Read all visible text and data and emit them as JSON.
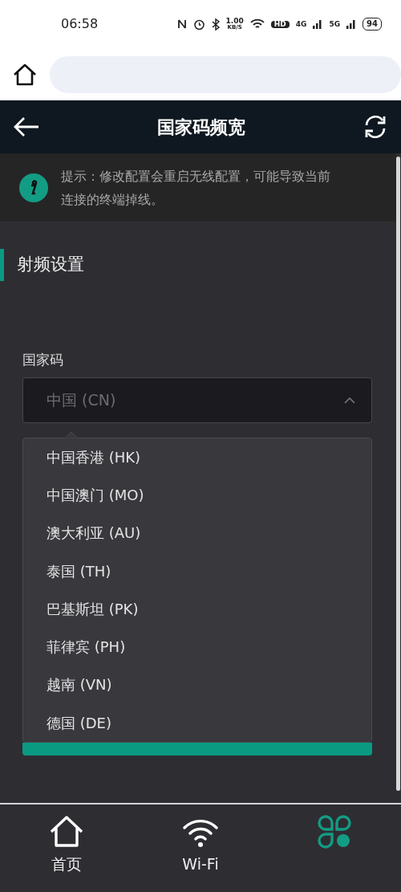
{
  "status_bar": {
    "time": "06:58",
    "net_speed": "1.00",
    "net_unit": "KB/S",
    "hd": "HD",
    "signal_1": "4G",
    "signal_2": "5G",
    "battery": "94"
  },
  "header": {
    "title": "国家码频宽"
  },
  "notice": {
    "text": "提示：修改配置会重启无线配置，可能导致当前连接的终端掉线。"
  },
  "section": {
    "title": "射频设置"
  },
  "country_field": {
    "label": "国家码",
    "value": "中国 (CN)",
    "expanded": true,
    "options": [
      {
        "label": "中国香港 (HK)"
      },
      {
        "label": "中国澳门 (MO)"
      },
      {
        "label": "澳大利亚 (AU)"
      },
      {
        "label": "泰国 (TH)"
      },
      {
        "label": "巴基斯坦 (PK)"
      },
      {
        "label": "菲律宾 (PH)"
      },
      {
        "label": "越南 (VN)"
      },
      {
        "label": "德国 (DE)"
      }
    ]
  },
  "bottom_nav": [
    {
      "kind": "home",
      "label": "首页",
      "selected": false
    },
    {
      "kind": "wifi",
      "label": "Wi-Fi",
      "selected": false
    },
    {
      "kind": "apps",
      "selected": true
    }
  ]
}
